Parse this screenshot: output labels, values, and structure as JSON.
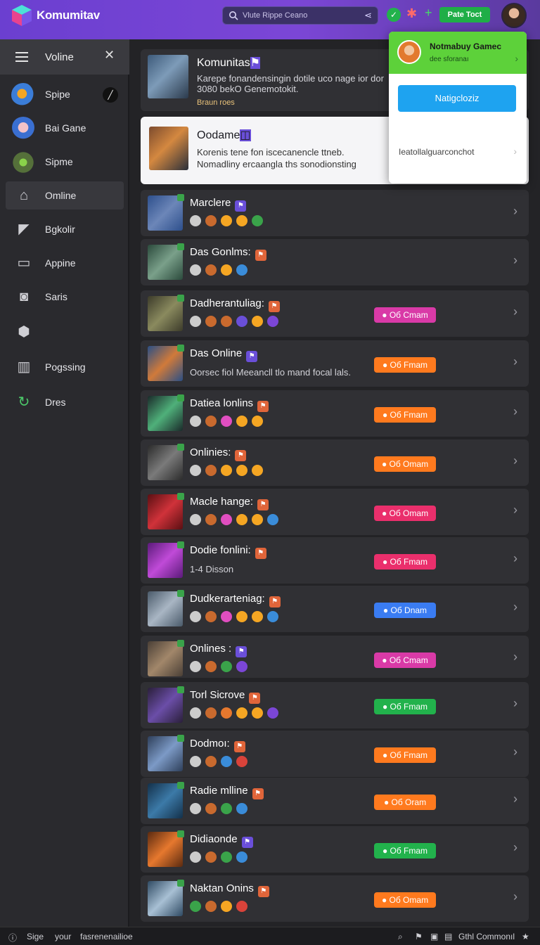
{
  "header": {
    "brand": "Komumitav",
    "search_placeholder": "Vlute Rippe Ceano",
    "top_button": "Pate Toct",
    "icons": [
      "logo-icon",
      "search-icon",
      "share-icon",
      "check-circle-icon",
      "gear-icon",
      "plus-icon",
      "avatar"
    ]
  },
  "sidebar": {
    "title": "Voline",
    "items": [
      {
        "label": "Spipe",
        "icon": "game-avatar-1"
      },
      {
        "label": "Bai Gane",
        "icon": "game-avatar-2"
      },
      {
        "label": "Sipme",
        "icon": "game-avatar-3"
      },
      {
        "label": "Omline",
        "icon": "storefront-icon"
      },
      {
        "label": "Bgkolir",
        "icon": "tag-icon"
      },
      {
        "label": "Appine",
        "icon": "card-icon"
      },
      {
        "label": "Saris",
        "icon": "bag-icon"
      },
      {
        "label": "",
        "icon": "shield-icon"
      },
      {
        "label": "Pogssing",
        "icon": "layout-icon"
      },
      {
        "label": "Dres",
        "icon": "refresh-icon"
      }
    ]
  },
  "popover": {
    "title": "Notmabuy Gamec",
    "subtitle": "dee sforanaı",
    "button": "Natigcloziz",
    "text": "Ieatollalguarconchot"
  },
  "featured": {
    "title": "Komunitas",
    "desc": "Karepe fonandensingin dotile uco nage ior dor 3080 bekO Genemotokit.",
    "meta": "Braun roes"
  },
  "highlight": {
    "title": "Oodame",
    "desc": "Korenis tene fon iscecanencle ttneb. Nomadliny ercaangla ths sonodionsting"
  },
  "rows": [
    {
      "title": "Marclere",
      "desc": "",
      "status": "",
      "status_color": ""
    },
    {
      "title": "Das Gonlms:",
      "desc": "",
      "status": "",
      "status_color": ""
    },
    {
      "title": "Dadherantuliag:",
      "desc": "",
      "status": "Oб Cmam",
      "status_color": "#d93aa7"
    },
    {
      "title": "Das Online",
      "desc": "Oorsec fiol Meeancll tlo mand focal lals.",
      "status": "Oб Fmam",
      "status_color": "#ff7a1e"
    },
    {
      "title": "Datiea lonlins",
      "desc": "",
      "status": "Oб Fmam",
      "status_color": "#ff7a1e"
    },
    {
      "title": "Onlinies:",
      "desc": "",
      "status": "Oб Omam",
      "status_color": "#ff7a1e"
    },
    {
      "title": "Macle hange:",
      "desc": "",
      "status": "Oб Omam",
      "status_color": "#ea2f6c"
    },
    {
      "title": "Dodie fonlini:",
      "desc": "1-4 Disson",
      "status": "Oб Fmam",
      "status_color": "#ea2f6c"
    },
    {
      "title": "Dudkerarteniag:",
      "desc": "",
      "status": "Oб Dnam",
      "status_color": "#3a7cf2"
    },
    {
      "title": "Onlines :",
      "desc": "",
      "status": "Oб Cmam",
      "status_color": "#d93aa7"
    },
    {
      "title": "Torl Sicrove",
      "desc": "",
      "status": "Oб Fmam",
      "status_color": "#22b24c"
    },
    {
      "title": "Dodmoı:",
      "desc": "",
      "status": "Oб Fmam",
      "status_color": "#ff7a1e"
    },
    {
      "title": "Radie mlline",
      "desc": "",
      "status": "Oб Oram",
      "status_color": "#ff7a1e"
    },
    {
      "title": "Didiaonde",
      "desc": "",
      "status": "Oб Fmam",
      "status_color": "#22b24c"
    },
    {
      "title": "Naktan Onins",
      "desc": "",
      "status": "Oб Omam",
      "status_color": "#ff7a1e"
    }
  ],
  "footer": {
    "left1": "Sige",
    "left2": "your",
    "left3": "fasrenenailioe",
    "right": "Gthl Commonıl"
  }
}
